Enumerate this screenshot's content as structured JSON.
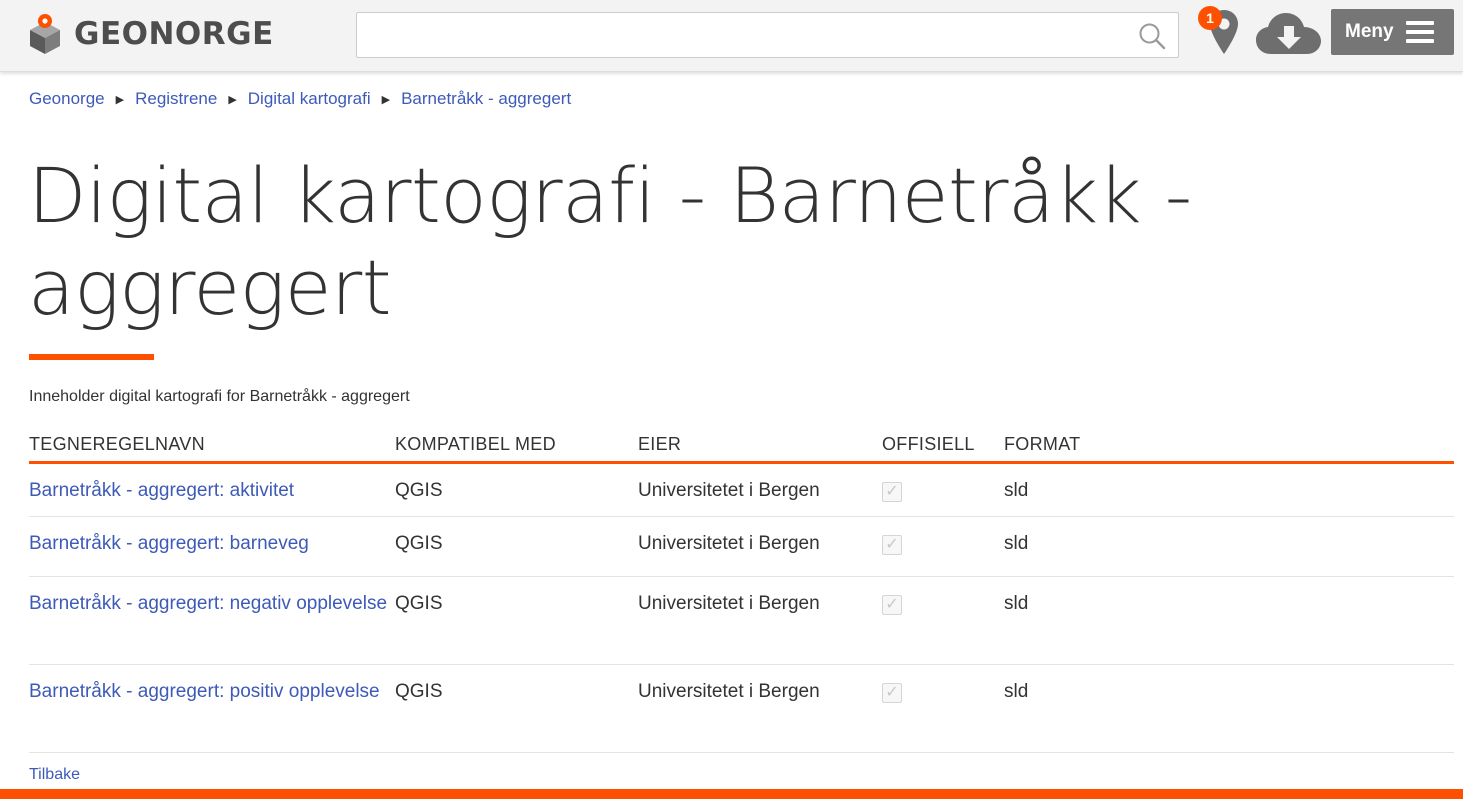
{
  "header": {
    "logo_text": "GEONORGE",
    "search": {
      "value": "",
      "placeholder": ""
    },
    "map_badge_count": "1",
    "menu_label": "Meny"
  },
  "breadcrumb": [
    {
      "label": "Geonorge"
    },
    {
      "label": "Registrene"
    },
    {
      "label": "Digital kartografi"
    },
    {
      "label": "Barnetråkk - aggregert"
    }
  ],
  "page": {
    "title": "Digital kartografi - Barnetråkk - aggregert",
    "intro": "Inneholder digital kartografi for Barnetråkk - aggregert"
  },
  "table": {
    "headers": [
      "TEGNEREGELNAVN",
      "KOMPATIBEL MED",
      "EIER",
      "OFFISIELL",
      "FORMAT"
    ],
    "rows": [
      {
        "name": "Barnetråkk - aggregert: aktivitet",
        "compatible": "QGIS",
        "owner": "Universitetet i Bergen",
        "official": true,
        "format": "sld"
      },
      {
        "name": "Barnetråkk - aggregert: barneveg",
        "compatible": "QGIS",
        "owner": "Universitetet i Bergen",
        "official": true,
        "format": "sld"
      },
      {
        "name": "Barnetråkk - aggregert: negativ opplevelse",
        "compatible": "QGIS",
        "owner": "Universitetet i Bergen",
        "official": true,
        "format": "sld"
      },
      {
        "name": "Barnetråkk - aggregert: positiv opplevelse",
        "compatible": "QGIS",
        "owner": "Universitetet i Bergen",
        "official": true,
        "format": "sld"
      }
    ]
  },
  "back_link": "Tilbake",
  "colors": {
    "accent": "#fe5000",
    "link": "#3d5ab8",
    "menu_bg": "#767676",
    "header_bg": "#f3f3f3"
  },
  "icons": {
    "logo": "geonorge-logo-icon",
    "search": "search-icon",
    "map": "map-marker-icon",
    "download": "cloud-download-icon",
    "menu": "hamburger-icon",
    "breadcrumb_separator": "triangle-right-icon",
    "checkbox": "checkbox-checked-icon"
  }
}
